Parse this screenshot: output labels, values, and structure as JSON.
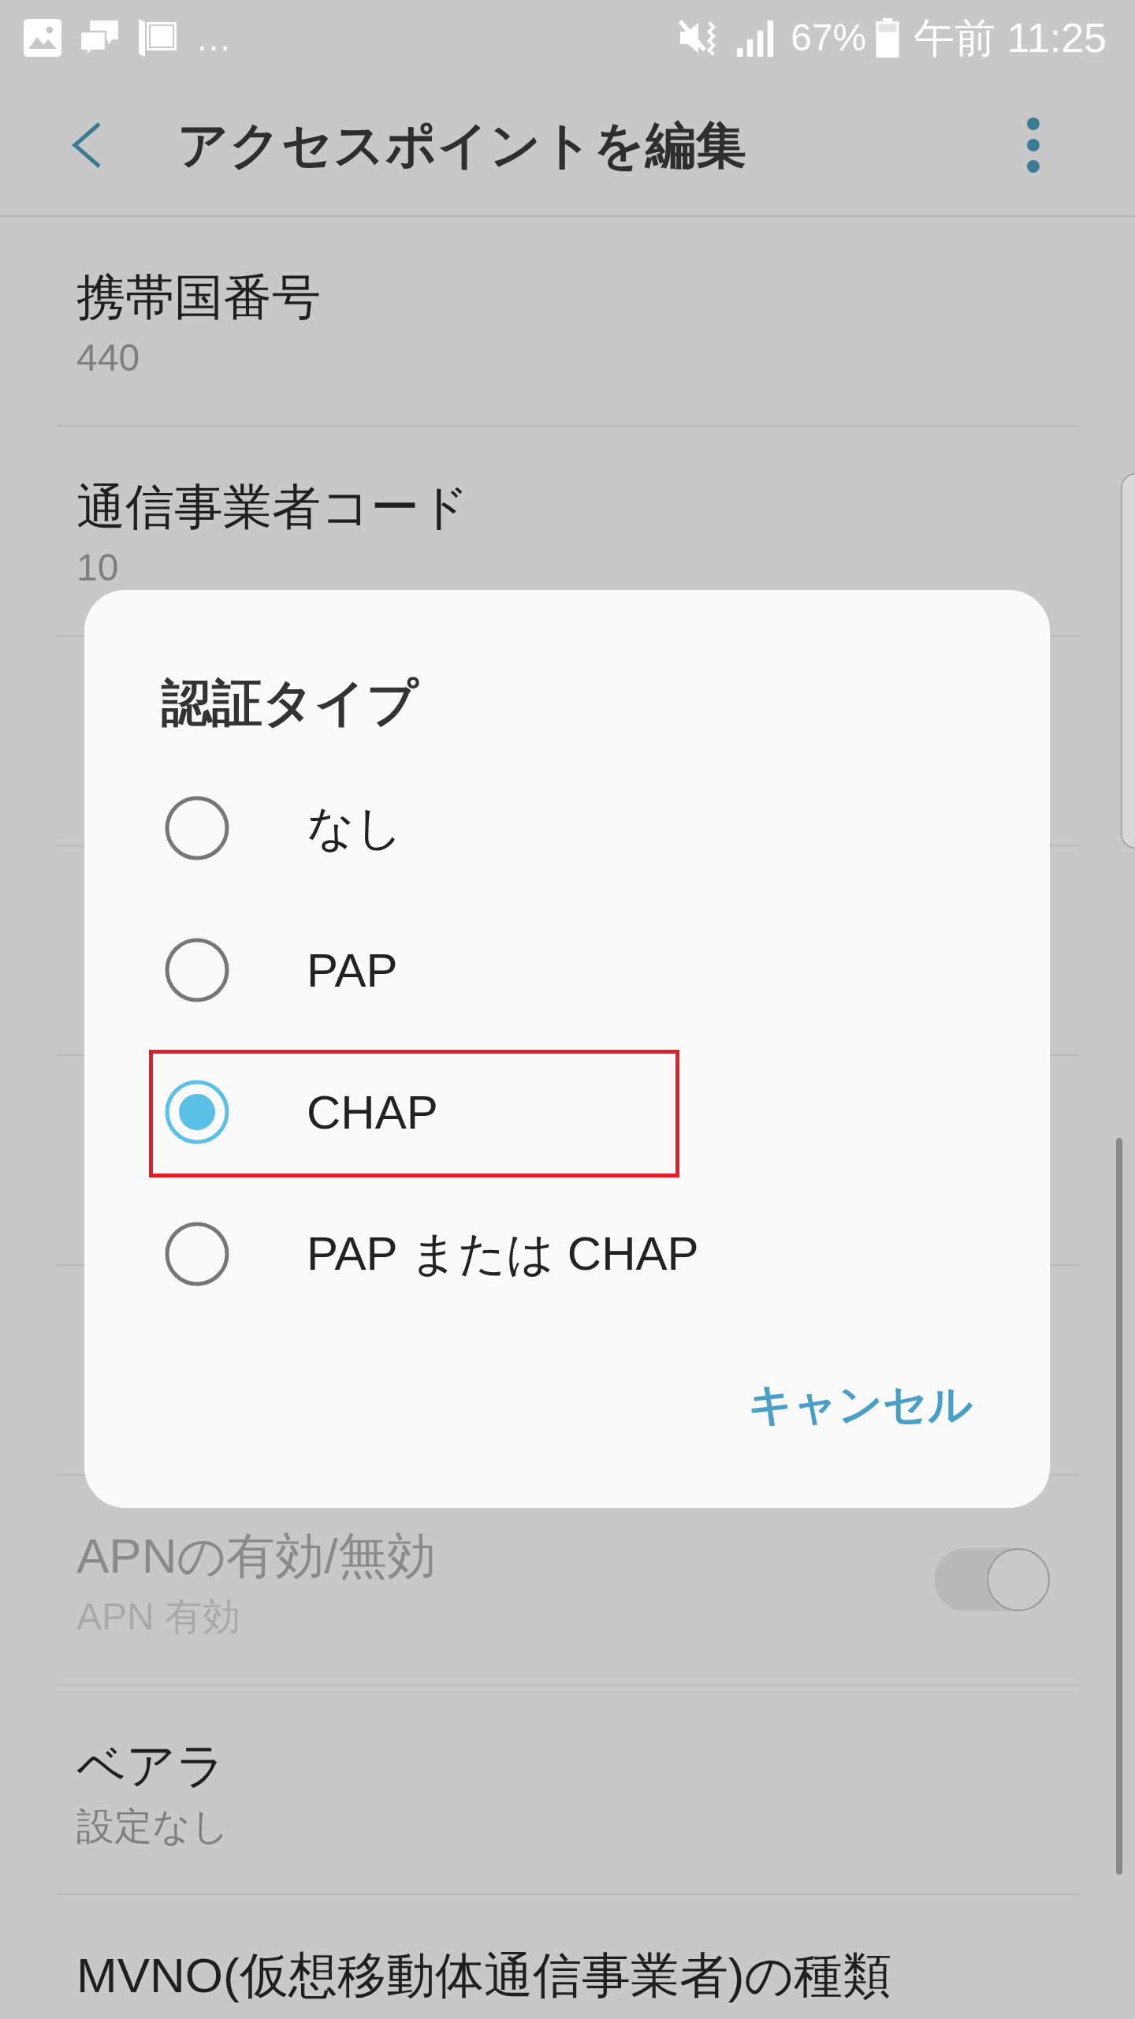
{
  "status_bar": {
    "notification_overflow": "…",
    "battery": "67%",
    "time": "午前 11:25"
  },
  "app_bar": {
    "title": "アクセスポイントを編集"
  },
  "settings_list": {
    "items_above_dialog": [
      {
        "kind": "text",
        "title": "携帯国番号",
        "value": "440",
        "disabled": false
      },
      {
        "kind": "text",
        "title": "通信事業者コード",
        "value": "10",
        "disabled": false
      }
    ],
    "items_below_dialog": [
      {
        "kind": "toggle",
        "title": "APNの有効/無効",
        "value": "APN 有効",
        "disabled": true,
        "on": true
      },
      {
        "kind": "text",
        "title": "ベアラ",
        "value": "設定なし",
        "disabled": false
      },
      {
        "kind": "text",
        "title": "MVNO(仮想移動体通信事業者)の種類",
        "disabled": false
      }
    ]
  },
  "dialog": {
    "title": "認証タイプ",
    "options": [
      {
        "label": "なし",
        "selected": false,
        "highlighted": false
      },
      {
        "label": "PAP",
        "selected": false,
        "highlighted": false
      },
      {
        "label": "CHAP",
        "selected": true,
        "highlighted": true
      },
      {
        "label": "PAP または CHAP",
        "selected": false,
        "highlighted": false
      }
    ],
    "buttons": [
      {
        "kind": "text",
        "label": "キャンセル"
      }
    ]
  }
}
